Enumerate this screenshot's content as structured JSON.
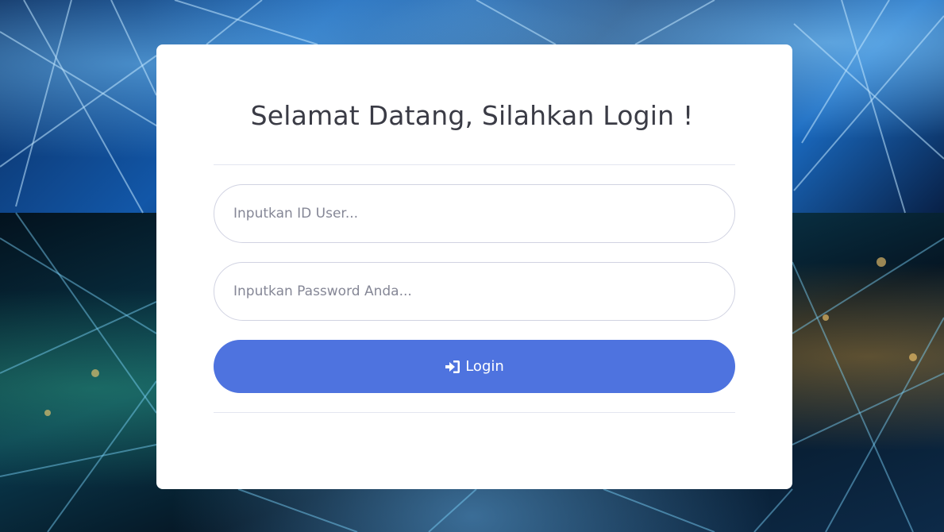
{
  "page": {
    "background": "circuit-network-photo"
  },
  "card": {
    "title": "Selamat Datang, Silahkan Login !"
  },
  "form": {
    "user_placeholder": "Inputkan ID User...",
    "user_value": "",
    "password_placeholder": "Inputkan Password Anda...",
    "password_value": "",
    "login_label": "Login",
    "login_icon": "sign-in-icon"
  },
  "colors": {
    "accent": "#4e73df",
    "title_text": "#3a3b45",
    "card_bg": "#ffffff",
    "border": "#d1d3e2"
  }
}
